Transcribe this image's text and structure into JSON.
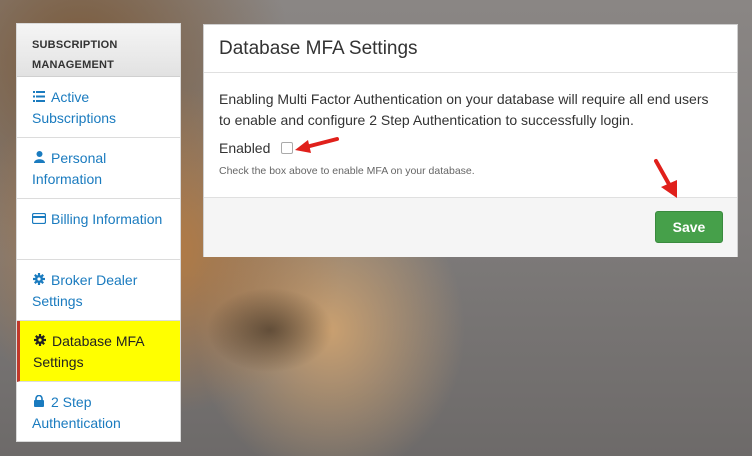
{
  "sidebar": {
    "header": "SUBSCRIPTION MANAGEMENT",
    "items": [
      {
        "icon": "list-icon",
        "label": "Active Subscriptions"
      },
      {
        "icon": "user-icon",
        "label": "Personal Information"
      },
      {
        "icon": "credit-card-icon",
        "label": "Billing Information"
      },
      {
        "icon": "gear-icon",
        "label": "Broker Dealer Settings"
      },
      {
        "icon": "gear-icon",
        "label": "Database MFA Settings",
        "active": true
      },
      {
        "icon": "lock-icon",
        "label": "2 Step Authentication"
      }
    ]
  },
  "panel": {
    "title": "Database MFA Settings",
    "description": "Enabling Multi Factor Authentication on your database will require all end users to enable and configure 2 Step Authentication to successfully login.",
    "enabled_label": "Enabled",
    "enabled_checked": false,
    "hint": "Check the box above to enable MFA on your database.",
    "save_label": "Save"
  },
  "colors": {
    "link": "#1a7bbf",
    "active_bg": "#ffff00",
    "active_border": "#c0392b",
    "save_button": "#46a04a",
    "annotation_arrow": "#e0201b"
  }
}
